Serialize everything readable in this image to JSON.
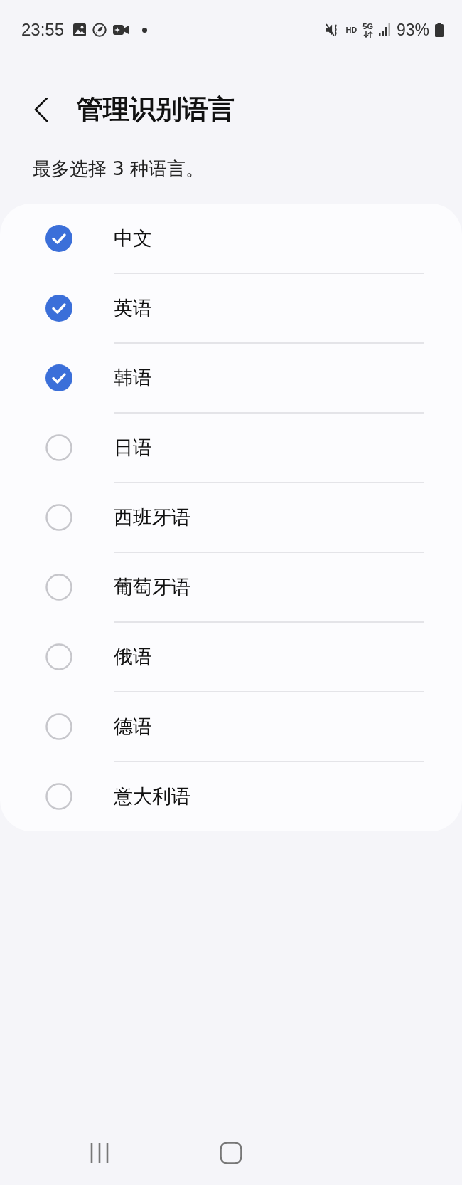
{
  "status_bar": {
    "time": "23:55",
    "hd_label": "HD",
    "network_label": "5G",
    "battery": "93%"
  },
  "header": {
    "title": "管理识别语言"
  },
  "hint": "最多选择 3 种语言。",
  "languages": [
    {
      "label": "中文",
      "checked": true
    },
    {
      "label": "英语",
      "checked": true
    },
    {
      "label": "韩语",
      "checked": true
    },
    {
      "label": "日语",
      "checked": false
    },
    {
      "label": "西班牙语",
      "checked": false
    },
    {
      "label": "葡萄牙语",
      "checked": false
    },
    {
      "label": "俄语",
      "checked": false
    },
    {
      "label": "德语",
      "checked": false
    },
    {
      "label": "意大利语",
      "checked": false
    }
  ]
}
